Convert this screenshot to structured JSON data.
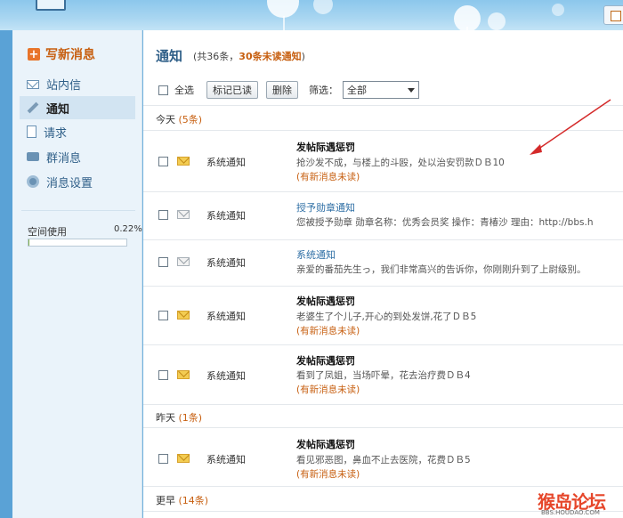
{
  "sidebar": {
    "compose": "写新消息",
    "items": [
      {
        "label": "站内信",
        "icon": "mail-icon",
        "active": false
      },
      {
        "label": "通知",
        "icon": "pencil-icon",
        "active": true
      },
      {
        "label": "请求",
        "icon": "document-icon",
        "active": false
      },
      {
        "label": "群消息",
        "icon": "chat-bubble-icon",
        "active": false
      },
      {
        "label": "消息设置",
        "icon": "settings-icon",
        "active": false
      }
    ],
    "space_label": "空间使用",
    "space_percent_text": "0.22%",
    "space_usage_fraction": 0.0022
  },
  "main": {
    "title": "通知",
    "summary_prefix": "(共36条，",
    "summary_unread": "30条未读通知",
    "summary_suffix": ")",
    "toolbar": {
      "select_all": "全选",
      "mark_read": "标记已读",
      "delete": "删除",
      "filter_label": "筛选：",
      "filter_value": "全部"
    },
    "groups": [
      {
        "label": "今天",
        "count": "(5条)"
      },
      {
        "label": "昨天",
        "count": "(1条)"
      },
      {
        "label": "更早",
        "count": "(14条)"
      }
    ],
    "rows": [
      {
        "source": "系统通知",
        "subject": "发帖际遇惩罚",
        "body": "抢沙发不成，与楼上的斗殴，处以治安罚款ＤＢ10",
        "flag": "(有新消息未读)",
        "unread": true
      },
      {
        "source": "系统通知",
        "subject": "授予勋章通知",
        "body": "您被授予勋章 勋章名称：优秀会员奖 操作：青椿沙 理由：http://bbs.h",
        "flag": "",
        "unread": false
      },
      {
        "source": "系统通知",
        "subject": "系统通知",
        "body": "亲爱的番茄先生っ，我们非常高兴的告诉你，你刚刚升到了上尉级别。",
        "flag": "",
        "unread": false
      },
      {
        "source": "系统通知",
        "subject": "发帖际遇惩罚",
        "body": "老婆生了个儿子,开心的到处发饼,花了ＤＢ5",
        "flag": "(有新消息未读)",
        "unread": true
      },
      {
        "source": "系统通知",
        "subject": "发帖际遇惩罚",
        "body": "看到了凤姐，当场吓晕，花去治疗费ＤＢ4",
        "flag": "(有新消息未读)",
        "unread": true
      },
      {
        "source": "系统通知",
        "subject": "发帖际遇惩罚",
        "body": "看见邪恶图，鼻血不止去医院，花费ＤＢ5",
        "flag": "(有新消息未读)",
        "unread": true
      }
    ]
  },
  "watermark": {
    "text": "猴岛论坛",
    "url": "BBS.HOUDAO.COM"
  },
  "colors": {
    "accent_orange": "#c75f10",
    "link_blue": "#2f6fa5",
    "arrow_red": "#d42a2a"
  }
}
